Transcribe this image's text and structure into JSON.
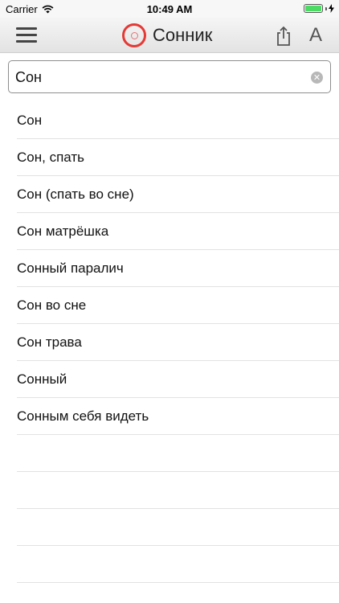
{
  "status_bar": {
    "carrier": "Carrier",
    "time": "10:49 AM"
  },
  "nav": {
    "title": "Сонник",
    "font_button_label": "A",
    "logo_color": "#e53935"
  },
  "search": {
    "value": "Сон",
    "placeholder": ""
  },
  "results": [
    {
      "label": "Сон"
    },
    {
      "label": "Сон, спать"
    },
    {
      "label": "Сон (спать во сне)"
    },
    {
      "label": "Сон матрёшка"
    },
    {
      "label": "Сонный паралич"
    },
    {
      "label": "Сон во сне"
    },
    {
      "label": "Сон трава"
    },
    {
      "label": "Сонный"
    },
    {
      "label": "Сонным себя видеть"
    }
  ],
  "icons": {
    "menu": "hamburger-menu-icon",
    "share": "share-icon",
    "clear": "clear-icon",
    "wifi": "wifi-icon",
    "battery": "battery-icon",
    "charging": "charging-bolt-icon"
  }
}
